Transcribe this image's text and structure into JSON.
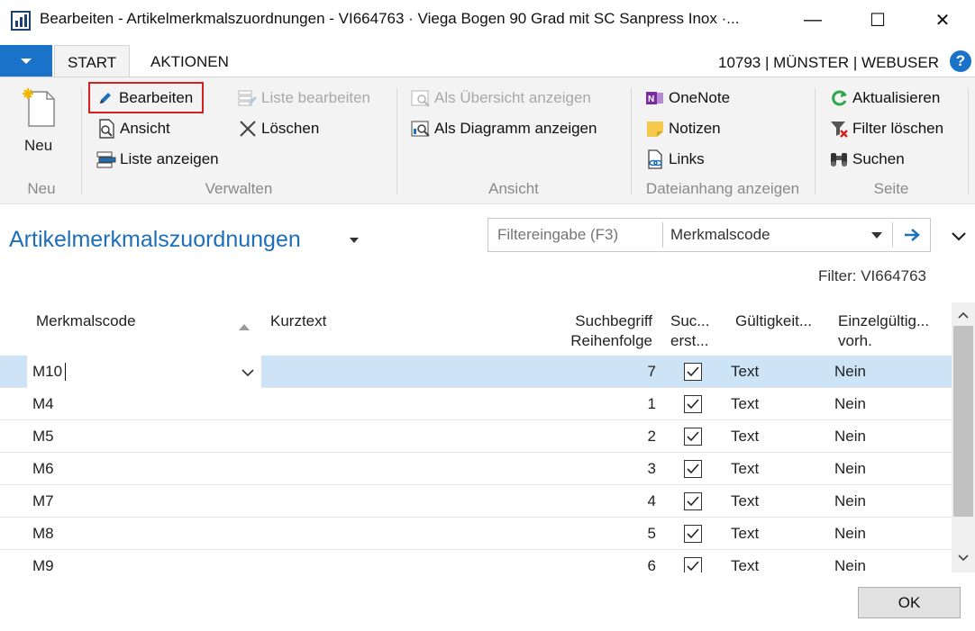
{
  "window": {
    "title": "Bearbeiten - Artikelmerkmalszuordnungen - VI664763 · Viega Bogen 90 Grad mit SC Sanpress Inox ·...",
    "minimize": "—",
    "maximize": "☐",
    "close": "✕"
  },
  "tabs": {
    "start": "START",
    "aktionen": "AKTIONEN"
  },
  "user_info": "10793 | MÜNSTER | WEBUSER",
  "help": "?",
  "ribbon": {
    "neu": {
      "new_label": "Neu",
      "group": "Neu"
    },
    "verwalten": {
      "group": "Verwalten",
      "bearbeiten": "Bearbeiten",
      "ansicht": "Ansicht",
      "liste_anzeigen": "Liste anzeigen",
      "liste_bearbeiten": "Liste bearbeiten",
      "loeschen": "Löschen"
    },
    "ansicht": {
      "group": "Ansicht",
      "uebersicht": "Als Übersicht anzeigen",
      "diagramm": "Als Diagramm anzeigen"
    },
    "dateianhang": {
      "group": "Dateianhang anzeigen",
      "onenote": "OneNote",
      "notizen": "Notizen",
      "links": "Links"
    },
    "seite": {
      "group": "Seite",
      "aktualisieren": "Aktualisieren",
      "filter_loeschen": "Filter löschen",
      "suchen": "Suchen"
    }
  },
  "page": {
    "title": "Artikelmerkmalszuordnungen",
    "filter_placeholder": "Filtereingabe (F3)",
    "filter_field": "Merkmalscode",
    "filter_status": "Filter: VI664763"
  },
  "columns": {
    "merkmalscode": "Merkmalscode",
    "kurztext": "Kurztext",
    "suchbegriff_1": "Suchbegriff",
    "suchbegriff_2": "Reihenfolge",
    "suc_1": "Suc...",
    "suc_2": "erst...",
    "gueltigkeit": "Gültigkeit...",
    "einzel_1": "Einzelgültig...",
    "einzel_2": "vorh."
  },
  "rows": [
    {
      "code": "M10",
      "kurztext": "",
      "reihenfolge": "7",
      "checked": true,
      "gueltigkeit": "Text",
      "einzel": "Nein"
    },
    {
      "code": "M4",
      "kurztext": "",
      "reihenfolge": "1",
      "checked": true,
      "gueltigkeit": "Text",
      "einzel": "Nein"
    },
    {
      "code": "M5",
      "kurztext": "",
      "reihenfolge": "2",
      "checked": true,
      "gueltigkeit": "Text",
      "einzel": "Nein"
    },
    {
      "code": "M6",
      "kurztext": "",
      "reihenfolge": "3",
      "checked": true,
      "gueltigkeit": "Text",
      "einzel": "Nein"
    },
    {
      "code": "M7",
      "kurztext": "",
      "reihenfolge": "4",
      "checked": true,
      "gueltigkeit": "Text",
      "einzel": "Nein"
    },
    {
      "code": "M8",
      "kurztext": "",
      "reihenfolge": "5",
      "checked": true,
      "gueltigkeit": "Text",
      "einzel": "Nein"
    },
    {
      "code": "M9",
      "kurztext": "",
      "reihenfolge": "6",
      "checked": true,
      "gueltigkeit": "Text",
      "einzel": "Nein"
    }
  ],
  "ok_button": "OK",
  "colors": {
    "accent": "#1e6fba",
    "tab_blue": "#1a73c9",
    "selected_row": "#cde4f7",
    "highlight_border": "#d62020"
  }
}
